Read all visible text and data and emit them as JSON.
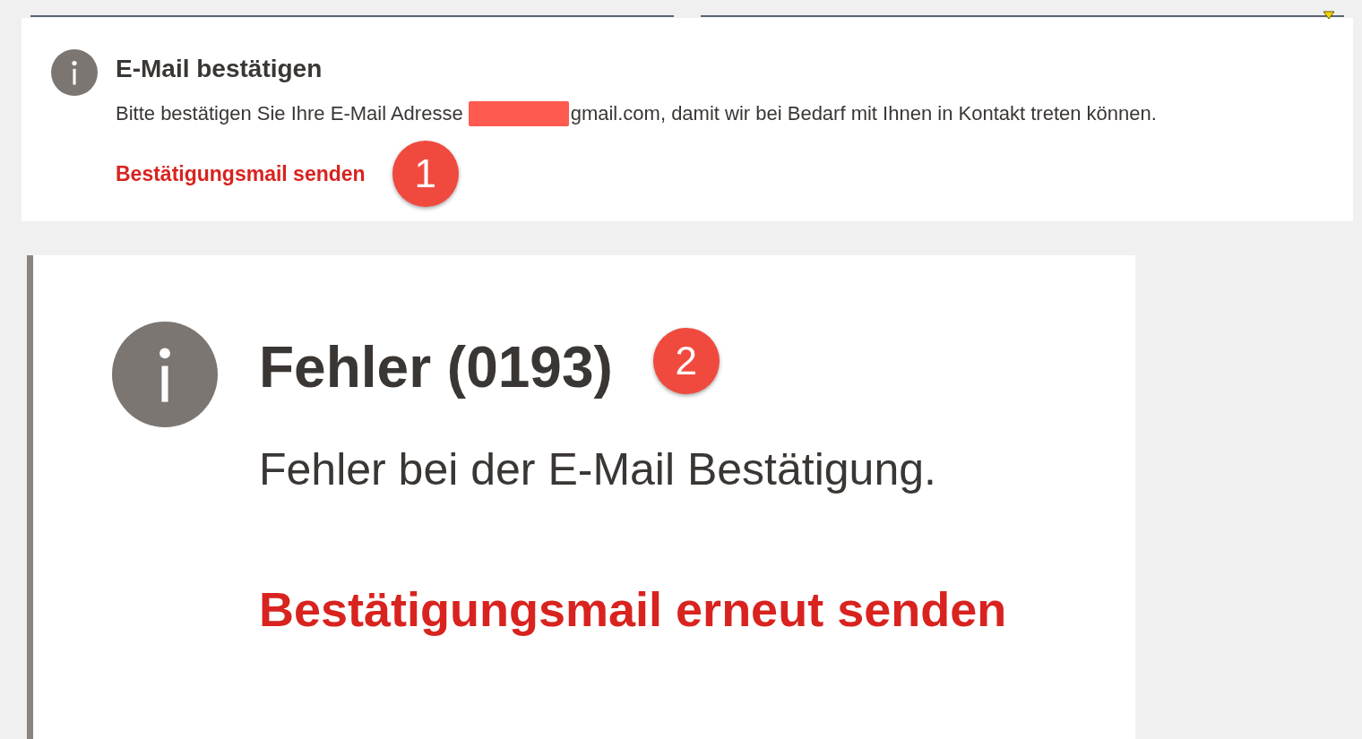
{
  "notices": [
    {
      "kind": "small",
      "title": "E-Mail bestätigen",
      "message_before": "Bitte bestätigen Sie Ihre E-Mail Adresse",
      "redacted": true,
      "message_after": "gmail.com, damit wir bei Bedarf mit Ihnen in Kontakt treten können.",
      "link": "Bestätigungsmail senden",
      "callout": "1"
    },
    {
      "kind": "large",
      "title": "Fehler (0193)",
      "message_before": "Fehler bei der E-Mail Bestätigung.",
      "redacted": false,
      "link": "Bestätigungsmail erneut senden",
      "callout": "2"
    }
  ]
}
